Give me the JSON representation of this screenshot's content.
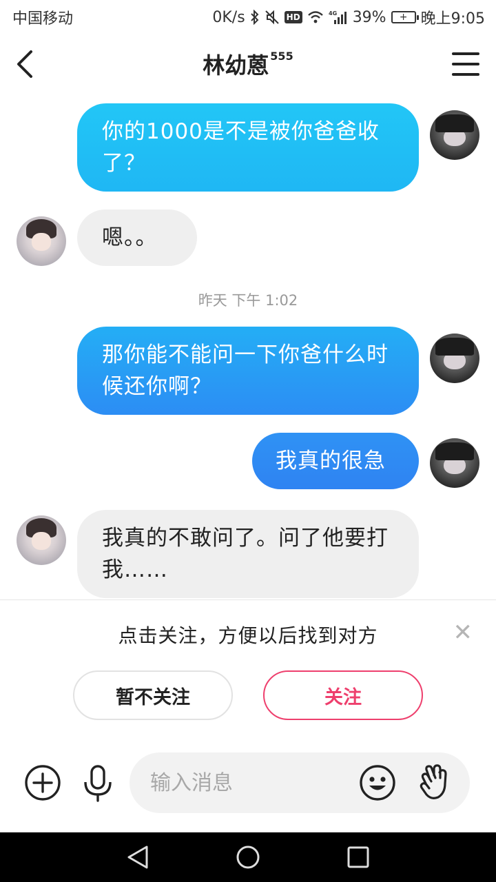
{
  "status_bar": {
    "carrier": "中国移动",
    "speed": "0K/s",
    "network": "4G",
    "battery": "39%",
    "time": "晚上9:05",
    "hd_label": "HD"
  },
  "header": {
    "title": "林幼蒽",
    "title_suffix": "555",
    "back_icon": "chevron-left-icon",
    "menu_icon": "hamburger-menu-icon"
  },
  "messages": [
    {
      "sender": "self",
      "text": "你的1000是不是被你爸爸收了？"
    },
    {
      "sender": "other",
      "text": "嗯。。"
    },
    {
      "sender": "self",
      "text": "那你能不能问一下你爸什么时候还你啊？"
    },
    {
      "sender": "self",
      "text": "我真的很急"
    },
    {
      "sender": "other",
      "text": "我真的不敢问了。问了他要打我……"
    }
  ],
  "timestamp": "昨天 下午 1:02",
  "follow_prompt": {
    "text": "点击关注，方便以后找到对方",
    "skip_label": "暂不关注",
    "follow_label": "关注",
    "close_icon": "close-icon"
  },
  "input_bar": {
    "placeholder": "输入消息",
    "icons": [
      "plus-circle-icon",
      "microphone-icon",
      "emoji-icon",
      "wave-hand-icon"
    ]
  },
  "colors": {
    "self_bubble_top": "#22c6f6",
    "self_bubble_bottom": "#2f83f2",
    "other_bubble": "#efefef",
    "follow_accent": "#ee3f6d"
  }
}
